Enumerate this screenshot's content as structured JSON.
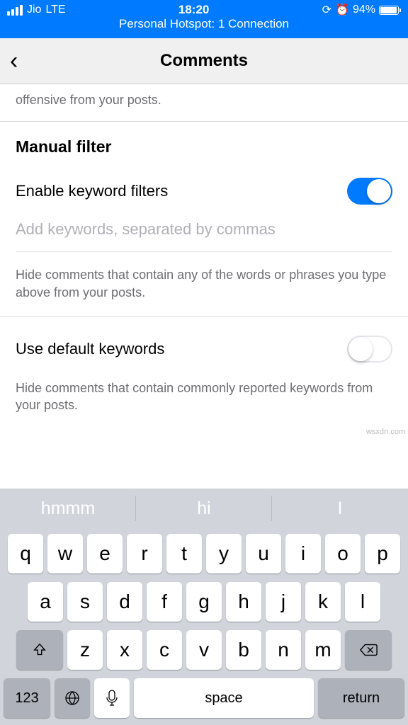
{
  "status": {
    "carrier": "Jio",
    "network": "LTE",
    "time": "18:20",
    "battery_pct": "94%",
    "hotspot": "Personal Hotspot: 1 Connection"
  },
  "nav": {
    "title": "Comments"
  },
  "prev_filter": {
    "cut_line": "offensive from your posts."
  },
  "manual": {
    "title": "Manual filter",
    "enable_label": "Enable keyword filters",
    "enable_on": true,
    "placeholder": "Add keywords, separated by commas",
    "help": "Hide comments that contain any of the words or phrases you type above from your posts."
  },
  "default_kw": {
    "label": "Use default keywords",
    "on": false,
    "help": "Hide comments that contain commonly reported keywords from your posts."
  },
  "keyboard": {
    "suggestions": [
      "hmmm",
      "hi",
      "I"
    ],
    "row1": [
      "q",
      "w",
      "e",
      "r",
      "t",
      "y",
      "u",
      "i",
      "o",
      "p"
    ],
    "row2": [
      "a",
      "s",
      "d",
      "f",
      "g",
      "h",
      "j",
      "k",
      "l"
    ],
    "row3": [
      "z",
      "x",
      "c",
      "v",
      "b",
      "n",
      "m"
    ],
    "num_key": "123",
    "space": "space",
    "return": "return"
  },
  "watermark": "wsxdn.com"
}
